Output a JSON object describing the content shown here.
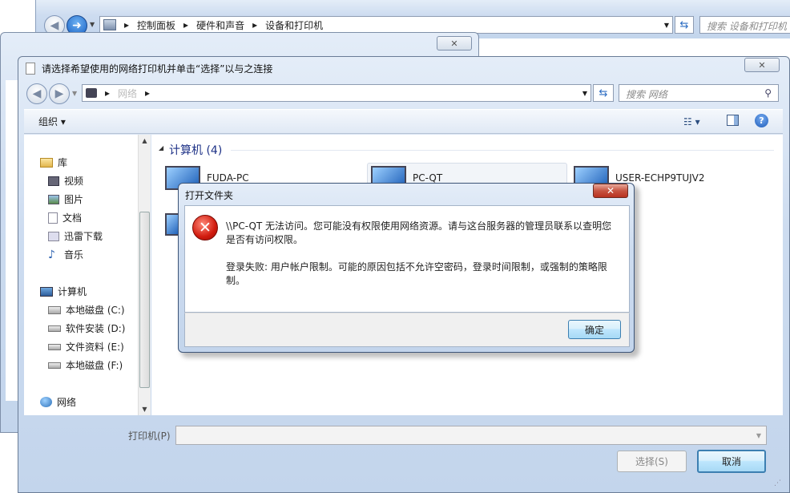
{
  "bg_window": {
    "breadcrumb": [
      "控制面板",
      "硬件和声音",
      "设备和打印机"
    ],
    "search_placeholder": "搜索 设备和打印机"
  },
  "dialog": {
    "title": "请选择希望使用的网络打印机并单击“选择”以与之连接",
    "breadcrumb": [
      "网络"
    ],
    "search_placeholder": "搜索 网络",
    "toolbar": {
      "organize": "组织 ▾"
    },
    "sidebar": {
      "libraries": {
        "label": "库",
        "items": [
          "视频",
          "图片",
          "文档",
          "迅雷下载",
          "音乐"
        ]
      },
      "computer": {
        "label": "计算机",
        "items": [
          "本地磁盘 (C:)",
          "软件安装 (D:)",
          "文件资料 (E:)",
          "本地磁盘 (F:)"
        ]
      },
      "network": {
        "label": "网络"
      }
    },
    "group_header": "计算机 (4)",
    "computers": [
      "FUDA-PC",
      "PC-QT",
      "USER-ECHP9TUJV2"
    ],
    "printer_label": "打印机(P)",
    "select_button": "选择(S)",
    "cancel_button": "取消"
  },
  "error_dialog": {
    "title": "打开文件夹",
    "message1": "\\\\PC-QT 无法访问。您可能没有权限使用网络资源。请与这台服务器的管理员联系以查明您是否有访问权限。",
    "message2": "登录失败: 用户帐户限制。可能的原因包括不允许空密码，登录时间限制，或强制的策略限制。",
    "ok_button": "确定"
  }
}
